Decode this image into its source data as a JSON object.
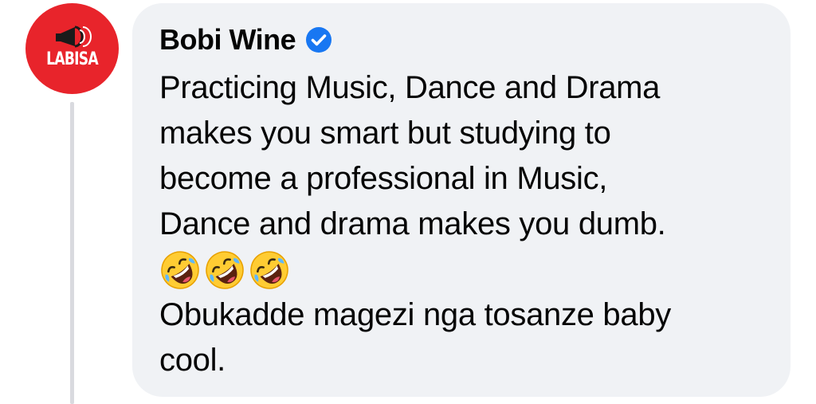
{
  "avatar": {
    "logo_text": "LABISA"
  },
  "comment": {
    "author": "Bobi Wine",
    "verified_icon": "verified-badge-icon",
    "lines": [
      "Practicing Music, Dance and Drama",
      "makes you smart but studying to",
      "become a professional in Music,",
      "Dance and drama makes you dumb."
    ],
    "emojis": [
      "🤣",
      "🤣",
      "🤣"
    ],
    "emoji_name": "rolling-on-floor-laughing-emoji",
    "closing_lines": [
      "Obukadde magezi nga tosanze baby",
      "cool."
    ]
  },
  "colors": {
    "avatar_bg": "#e8242b",
    "bubble_bg": "#f0f2f5",
    "verified_blue": "#1877f2",
    "text": "#050505"
  }
}
